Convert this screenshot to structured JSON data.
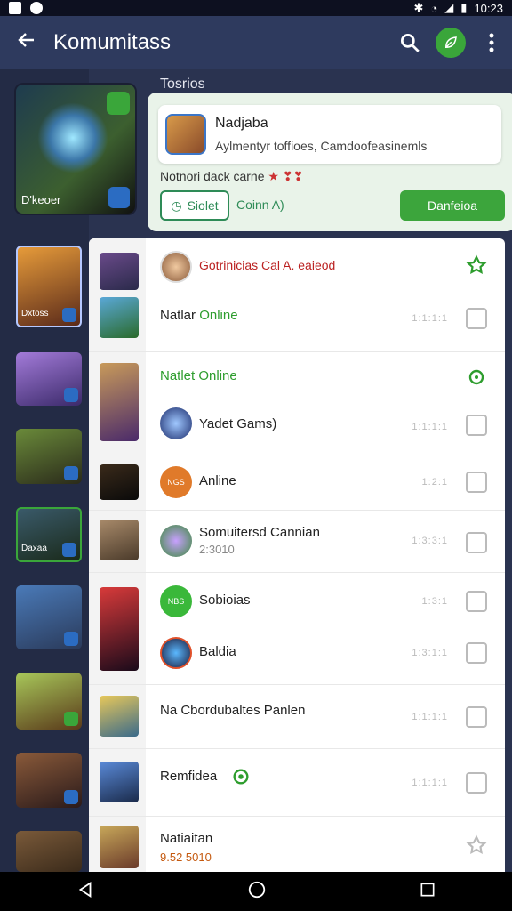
{
  "status_bar": {
    "time": "10:23"
  },
  "app_bar": {
    "title": "Komumitass",
    "back_icon": "back-arrow-icon",
    "actions": [
      "search-icon",
      "leaf-icon",
      "more-vert-icon"
    ]
  },
  "left_rail": {
    "hero_label": "D'keoer",
    "thumb_labels": [
      "Dxtoss",
      "",
      "",
      "Daxaa",
      "",
      "",
      "",
      ""
    ]
  },
  "section_title": "Tosrios",
  "top_card": {
    "name": "Nadjaba",
    "description": "Aylmentyr toffioes, Camdoofeasinemls",
    "subtitle": "Notnori dack carne",
    "subtitle_accent": "★ ❣❣",
    "btn_select": "Siolet",
    "btn_comment": "Coinn A)",
    "btn_primary": "Danfeioa"
  },
  "list_rows": [
    {
      "title": "Gotrinicias Cal A. eaieod",
      "meta": "",
      "variant": "red"
    },
    {
      "title": "Natlar Online",
      "title_main": "Natlar",
      "title_status": "Online",
      "meta": "1:1:1:1"
    },
    {
      "title": "Natlet Online",
      "meta": ""
    },
    {
      "title": "Yadet Gams)",
      "meta": "1:1:1:1"
    },
    {
      "title": "Anline",
      "avatar_text": "NGS",
      "meta": "1:2:1"
    },
    {
      "title": "Somuitersd Cannian",
      "sub": "2:3010",
      "meta": "1:3:3:1"
    },
    {
      "title": "Sobioias",
      "avatar_text": "NBS",
      "meta": "1:3:1"
    },
    {
      "title": "Baldia",
      "meta": "1:3:1:1"
    },
    {
      "title": "Na Cbordubaltes Panlen",
      "meta": "1:1:1:1"
    },
    {
      "title": "Remfidea",
      "meta": "1:1:1:1"
    },
    {
      "title": "Natiaitan",
      "sub": "9.52 5010",
      "meta": ""
    }
  ],
  "colors": {
    "appbar": "#2e3a5e",
    "accent_green": "#3ca53c",
    "card_bg": "#e9f3e9"
  },
  "nav_bar": {
    "icons": [
      "nav-back-icon",
      "nav-home-icon",
      "nav-recents-icon"
    ]
  }
}
